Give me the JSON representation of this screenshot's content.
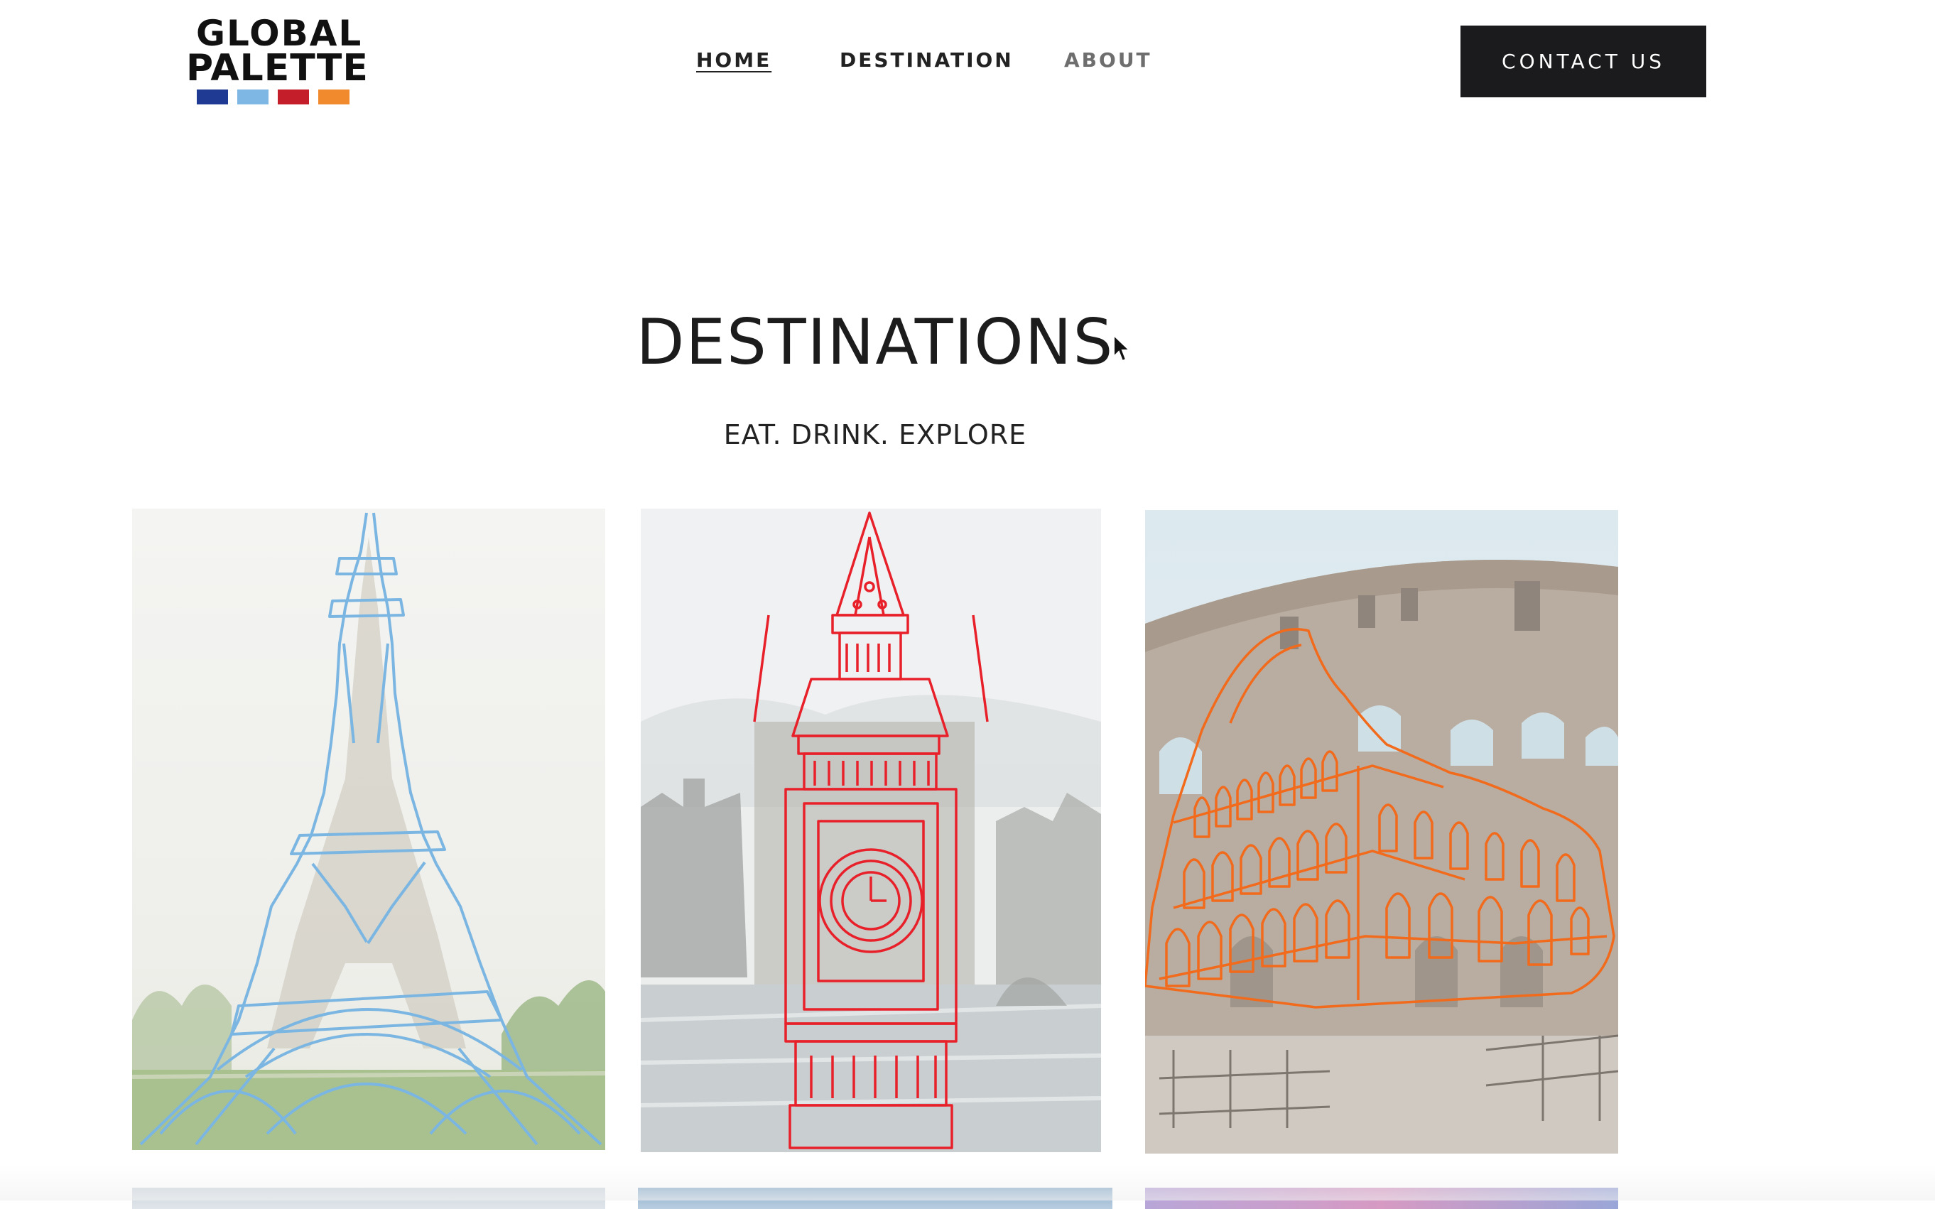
{
  "header": {
    "logo": {
      "line1": "GLOBAL",
      "line2": "PALETTE",
      "swatches": [
        "#1f3a93",
        "#7fb7e4",
        "#c41e2a",
        "#f08a2c"
      ]
    },
    "nav": {
      "home": "HOME",
      "destination": "DESTINATION",
      "about": "ABOUT"
    },
    "contact_label": "CONTACT US"
  },
  "hero": {
    "title": "DESTINATIONS",
    "subtitle": "EAT. DRINK. EXPLORE"
  },
  "colors": {
    "paris_outline": "#7bb6e2",
    "london_outline": "#e8202a",
    "rome_outline": "#f26a1b",
    "button_bg": "#1b1b1d"
  },
  "cards": [
    {
      "name": "paris",
      "icon": "eiffel-tower-icon"
    },
    {
      "name": "london",
      "icon": "big-ben-icon"
    },
    {
      "name": "rome",
      "icon": "colosseum-icon"
    }
  ]
}
